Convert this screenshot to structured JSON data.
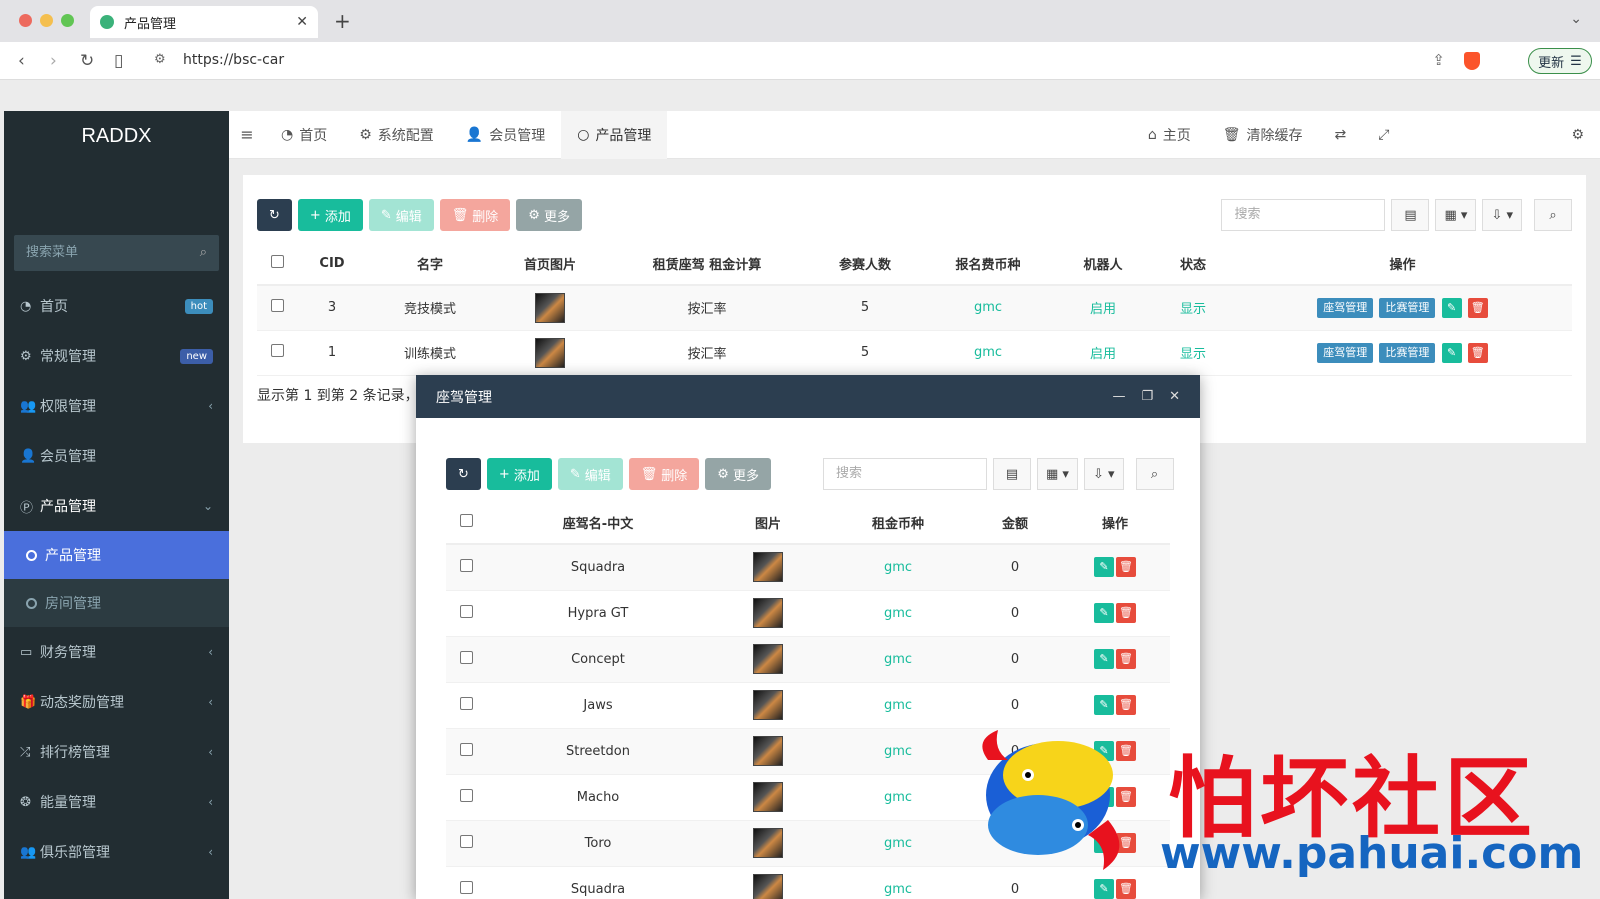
{
  "browser": {
    "tab_title": "产品管理",
    "url": "https://bsc-car",
    "update_label": "更新"
  },
  "sidebar": {
    "logo": "RADDX",
    "search_placeholder": "搜索菜单",
    "items": [
      {
        "label": "首页",
        "badge": "hot",
        "icon": "dashboard-icon"
      },
      {
        "label": "常规管理",
        "badge": "new",
        "icon": "cogs-icon"
      },
      {
        "label": "权限管理",
        "icon": "group-icon"
      },
      {
        "label": "会员管理",
        "icon": "user-icon"
      },
      {
        "label": "产品管理",
        "icon": "product-icon"
      }
    ],
    "sub_items": [
      {
        "label": "产品管理"
      },
      {
        "label": "房间管理"
      }
    ],
    "items_after": [
      {
        "label": "财务管理",
        "icon": "card-icon"
      },
      {
        "label": "动态奖励管理",
        "icon": "gift-icon"
      },
      {
        "label": "排行榜管理",
        "icon": "random-icon"
      },
      {
        "label": "能量管理",
        "icon": "energy-icon"
      },
      {
        "label": "俱乐部管理",
        "icon": "club-icon"
      }
    ]
  },
  "topnav": {
    "tabs": [
      "首页",
      "系统配置",
      "会员管理",
      "产品管理"
    ],
    "right": [
      "主页",
      "清除缓存"
    ]
  },
  "toolbar": {
    "add": "添加",
    "edit": "编辑",
    "delete": "删除",
    "more": "更多",
    "search_placeholder": "搜索"
  },
  "main_table": {
    "headers": [
      "CID",
      "名字",
      "首页图片",
      "租赁座驾 租金计算",
      "参赛人数",
      "报名费币种",
      "机器人",
      "状态",
      "操作"
    ],
    "rows": [
      {
        "cid": "3",
        "name": "竞技模式",
        "calc": "按汇率",
        "players": "5",
        "coin": "gmc",
        "robot": "启用",
        "status": "显示"
      },
      {
        "cid": "1",
        "name": "训练模式",
        "calc": "按汇率",
        "players": "5",
        "coin": "gmc",
        "robot": "启用",
        "status": "显示"
      }
    ],
    "action_labels": [
      "座驾管理",
      "比赛管理"
    ],
    "page_info": "显示第 1 到第 2 条记录，"
  },
  "modal": {
    "title": "座驾管理",
    "headers": [
      "座驾名-中文",
      "图片",
      "租金币种",
      "金额",
      "操作"
    ],
    "rows": [
      {
        "name": "Squadra",
        "coin": "gmc",
        "amount": "0"
      },
      {
        "name": "Hypra GT",
        "coin": "gmc",
        "amount": "0"
      },
      {
        "name": "Concept",
        "coin": "gmc",
        "amount": "0"
      },
      {
        "name": "Jaws",
        "coin": "gmc",
        "amount": "0"
      },
      {
        "name": "Streetdon",
        "coin": "gmc",
        "amount": "0"
      },
      {
        "name": "Macho",
        "coin": "gmc",
        "amount": "0"
      },
      {
        "name": "Toro",
        "coin": "gmc",
        "amount": "0"
      },
      {
        "name": "Squadra",
        "coin": "gmc",
        "amount": "0"
      }
    ]
  },
  "watermark": {
    "title": "怕坏社区",
    "url": "www.pahuai.com"
  },
  "colors": {
    "sidebar_bg": "#222d32",
    "active_menu": "#4a6fdc",
    "primary_dark": "#2c3e50",
    "success": "#18bc9c",
    "danger": "#e74c3c",
    "info": "#3c8dbc"
  }
}
